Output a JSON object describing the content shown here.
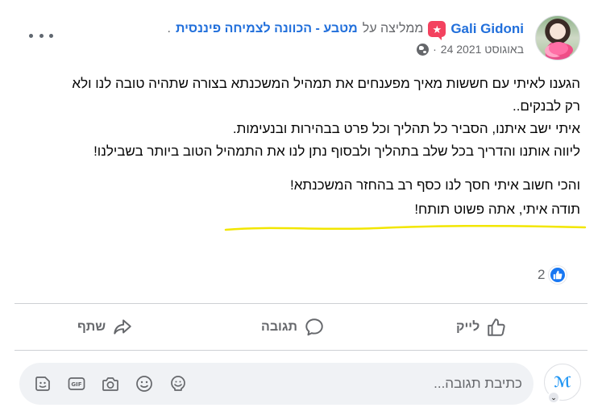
{
  "post": {
    "author": "Gali Gidoni",
    "recommend_text": "ממליצה על",
    "page_name": "מטבע - הכוונה לצמיחה פיננסית",
    "trailing_dot": ".",
    "date": "24 באוגוסט 2021",
    "separator": "·",
    "paragraphs": [
      "הגענו לאיתי עם חששות מאיך מפענחים את תמהיל המשכנתא בצורה שתהיה טובה לנו ולא רק לבנקים..",
      " איתי ישב איתנו, הסביר כל תהליך וכל פרט בבהירות ובנעימות.",
      "ליווה אותנו והדריך בכל שלב בתהליך ולבסוף נתן לנו את התמהיל הטוב ביותר בשבילנו!"
    ],
    "highlight": "והכי חשוב איתי חסך לנו כסף רב בהחזר המשכנתא!",
    "closing": "תודה איתי, אתה פשוט תותח!",
    "reaction_count": "2",
    "highlight_color": "#f2e600"
  },
  "actions": {
    "like": "לייק",
    "comment": "תגובה",
    "share": "שתף"
  },
  "composer": {
    "placeholder": "כתיבת תגובה...",
    "icons": [
      "sticker-icon",
      "gif-icon",
      "camera-icon",
      "emoji-icon",
      "avatar-sticker-icon"
    ]
  },
  "colors": {
    "link": "#216fdb",
    "muted": "#65676b",
    "like_blue": "#1877f2",
    "badge_red": "#f3425f"
  }
}
